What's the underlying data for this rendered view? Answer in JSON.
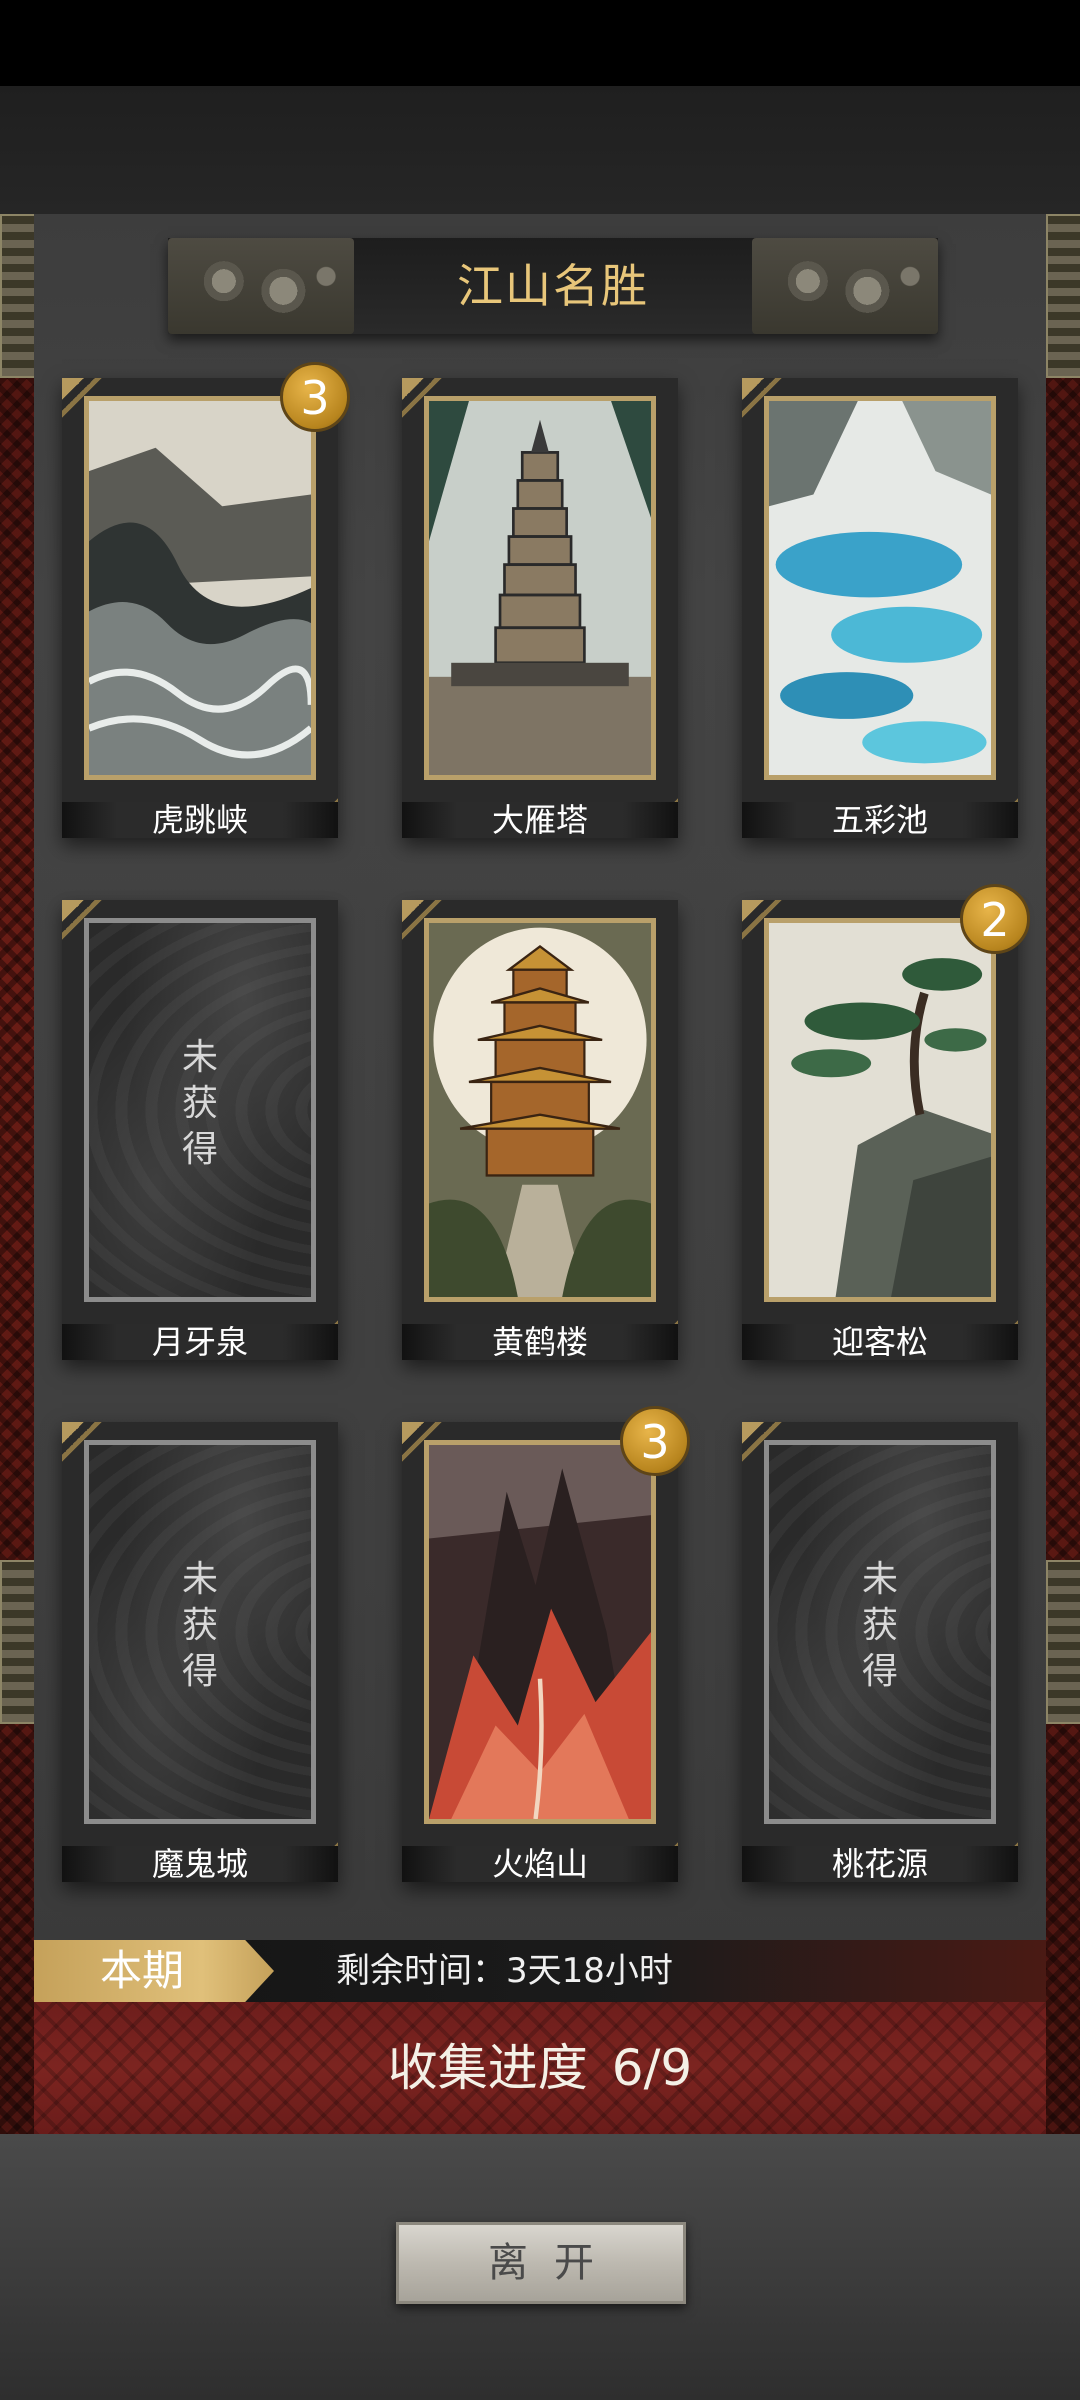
{
  "title": "江山名胜",
  "cards": [
    {
      "name": "虎跳峡",
      "badge": "3",
      "locked": false,
      "art": "waves-gorge"
    },
    {
      "name": "大雁塔",
      "badge": "",
      "locked": false,
      "art": "pagoda"
    },
    {
      "name": "五彩池",
      "badge": "",
      "locked": false,
      "art": "pools"
    },
    {
      "name": "月牙泉",
      "badge": "",
      "locked": true,
      "lock_label": [
        "未",
        "获",
        "得"
      ]
    },
    {
      "name": "黄鹤楼",
      "badge": "",
      "locked": false,
      "art": "tower"
    },
    {
      "name": "迎客松",
      "badge": "2",
      "locked": false,
      "art": "pine"
    },
    {
      "name": "魔鬼城",
      "badge": "",
      "locked": true,
      "lock_label": [
        "未",
        "获",
        "得"
      ]
    },
    {
      "name": "火焰山",
      "badge": "3",
      "locked": false,
      "art": "fire-mountain"
    },
    {
      "name": "桃花源",
      "badge": "",
      "locked": true,
      "lock_label": [
        "未",
        "获",
        "得"
      ]
    }
  ],
  "period": {
    "tag": "本期",
    "time_remaining": "剩余时间：3天18小时"
  },
  "progress": {
    "label": "收集进度",
    "value": "6/9"
  },
  "leave_button": "离开",
  "colors": {
    "gold": "#e8c67a",
    "red": "#7c2420",
    "badge": "#c9921f"
  }
}
